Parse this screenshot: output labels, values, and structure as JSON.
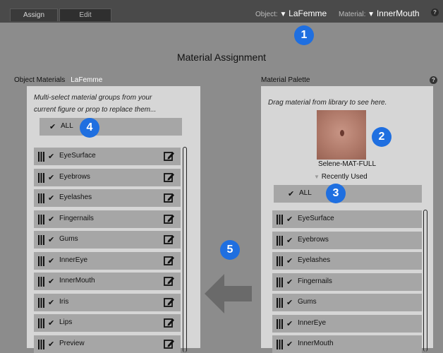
{
  "tabs": [
    {
      "label": "Assign"
    },
    {
      "label": "Edit"
    }
  ],
  "topbar": {
    "object_label": "Object:",
    "object_value": "LaFemme",
    "material_label": "Material:",
    "material_value": "InnerMouth",
    "help": "?"
  },
  "title": "Material Assignment",
  "object_materials": {
    "header": "Object Materials",
    "object_name": "LaFemme",
    "hint_line1": "Multi-select material groups from your",
    "hint_line2": "current figure or prop to replace them...",
    "all_label": "ALL",
    "items": [
      {
        "label": "EyeSurface"
      },
      {
        "label": "Eyebrows"
      },
      {
        "label": "Eyelashes"
      },
      {
        "label": "Fingernails"
      },
      {
        "label": "Gums"
      },
      {
        "label": "InnerEye"
      },
      {
        "label": "InnerMouth"
      },
      {
        "label": "Iris"
      },
      {
        "label": "Lips"
      },
      {
        "label": "Preview"
      }
    ]
  },
  "material_palette": {
    "header": "Material Palette",
    "help": "?",
    "hint": "Drag material from library to see here.",
    "swatch_name": "Selene-MAT-FULL",
    "recent_label": "Recently Used",
    "all_label": "ALL",
    "items": [
      {
        "label": "EyeSurface"
      },
      {
        "label": "Eyebrows"
      },
      {
        "label": "Eyelashes"
      },
      {
        "label": "Fingernails"
      },
      {
        "label": "Gums"
      },
      {
        "label": "InnerEye"
      },
      {
        "label": "InnerMouth"
      }
    ]
  },
  "callouts": [
    "1",
    "2",
    "3",
    "4",
    "5"
  ],
  "colors": {
    "badge": "#1f6fe0",
    "panel": "#d6d6d6",
    "row": "#a6a6a6",
    "topbar": "#4a4a4a"
  }
}
